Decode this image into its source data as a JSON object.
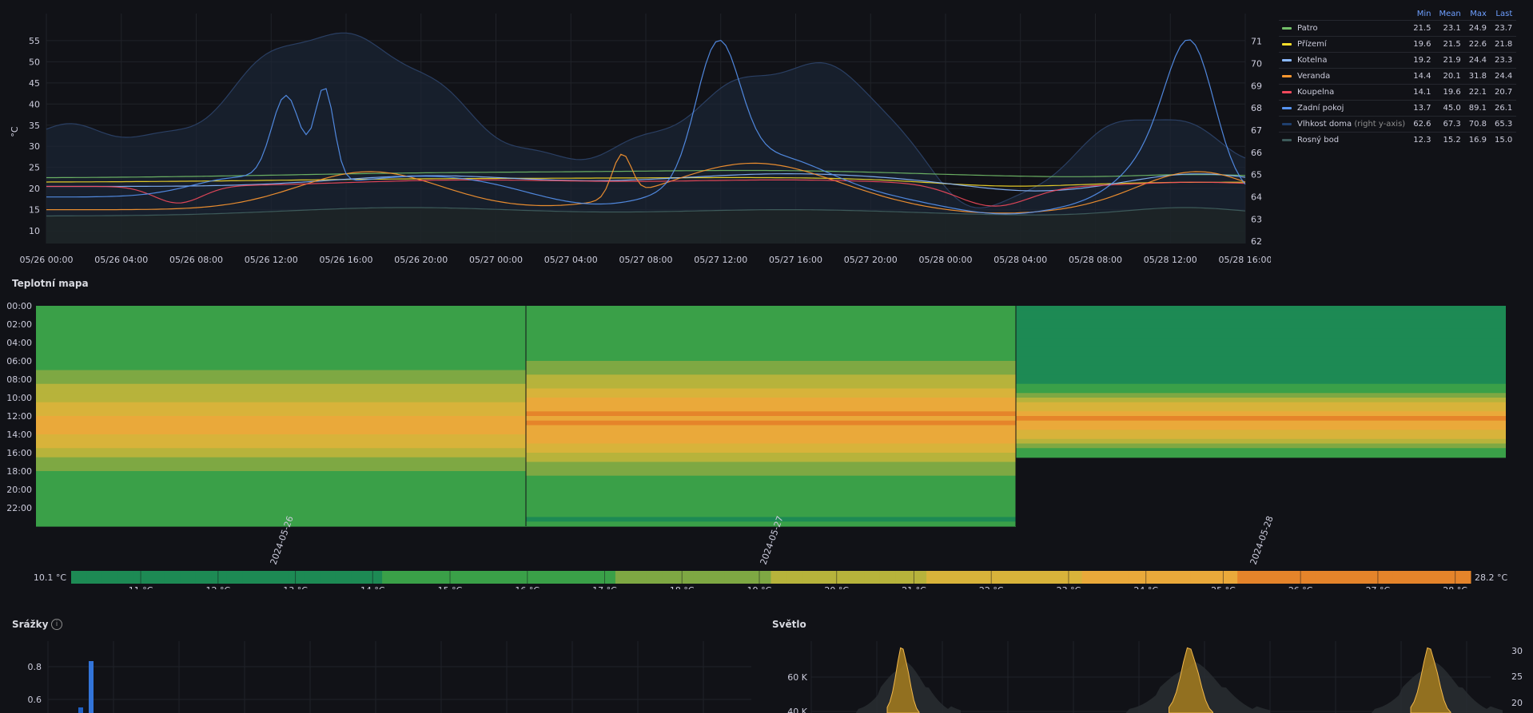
{
  "top_chart": {
    "left_axis_label": "°C",
    "right_axis_label": "%",
    "left_ticks": [
      "55",
      "50",
      "45",
      "40",
      "35",
      "30",
      "25",
      "20",
      "15",
      "10"
    ],
    "right_ticks": [
      "71",
      "70",
      "69",
      "68",
      "67",
      "66",
      "65",
      "64",
      "63",
      "62"
    ],
    "x_ticks": [
      "05/26 00:00",
      "05/26 04:00",
      "05/26 08:00",
      "05/26 12:00",
      "05/26 16:00",
      "05/26 20:00",
      "05/27 00:00",
      "05/27 04:00",
      "05/27 08:00",
      "05/27 12:00",
      "05/27 16:00",
      "05/27 20:00",
      "05/28 00:00",
      "05/28 04:00",
      "05/28 08:00",
      "05/28 12:00",
      "05/28 16:00"
    ]
  },
  "legend": {
    "headers": [
      "Min",
      "Mean",
      "Max",
      "Last"
    ],
    "rows": [
      {
        "name": "Patro",
        "suffix": "",
        "color": "#73bf69",
        "min": "21.5",
        "mean": "23.1",
        "max": "24.9",
        "last": "23.7"
      },
      {
        "name": "Přízemí",
        "suffix": "",
        "color": "#fade2a",
        "min": "19.6",
        "mean": "21.5",
        "max": "22.6",
        "last": "21.8"
      },
      {
        "name": "Kotelna",
        "suffix": "",
        "color": "#8ab8ff",
        "min": "19.2",
        "mean": "21.9",
        "max": "24.4",
        "last": "23.3"
      },
      {
        "name": "Veranda",
        "suffix": "",
        "color": "#ff9830",
        "min": "14.4",
        "mean": "20.1",
        "max": "31.8",
        "last": "24.4"
      },
      {
        "name": "Koupelna",
        "suffix": "",
        "color": "#f2495c",
        "min": "14.1",
        "mean": "19.6",
        "max": "22.1",
        "last": "20.7"
      },
      {
        "name": "Zadní pokoj",
        "suffix": "",
        "color": "#5794f2",
        "min": "13.7",
        "mean": "45.0",
        "max": "89.1",
        "last": "26.1"
      },
      {
        "name": "Vlhkost doma",
        "suffix": "(right y-axis)",
        "color": "#1f3f6e",
        "min": "62.6",
        "mean": "67.3",
        "max": "70.8",
        "last": "65.3"
      },
      {
        "name": "Rosný bod",
        "suffix": "",
        "color": "#3d5a5a",
        "min": "12.3",
        "mean": "15.2",
        "max": "16.9",
        "last": "15.0"
      }
    ]
  },
  "heatmap": {
    "title": "Teplotní mapa",
    "y_ticks": [
      "00:00",
      "02:00",
      "04:00",
      "06:00",
      "08:00",
      "10:00",
      "12:00",
      "14:00",
      "16:00",
      "18:00",
      "20:00",
      "22:00"
    ],
    "x_ticks": [
      "2024-05-26",
      "2024-05-27",
      "2024-05-28"
    ],
    "scale_min": "10.1 °C",
    "scale_max": "28.2 °C",
    "scale_ticks": [
      "11 °C",
      "12 °C",
      "13 °C",
      "14 °C",
      "15 °C",
      "16 °C",
      "17 °C",
      "18 °C",
      "19 °C",
      "20 °C",
      "21 °C",
      "22 °C",
      "23 °C",
      "24 °C",
      "25 °C",
      "26 °C",
      "27 °C",
      "28 °C"
    ]
  },
  "precip": {
    "title": "Srážky",
    "y_ticks": [
      "0.8",
      "0.6"
    ]
  },
  "light": {
    "title": "Světlo",
    "y_ticks": [
      "60 K",
      "40 K"
    ],
    "right_ticks": [
      "30",
      "25",
      "20"
    ]
  }
}
